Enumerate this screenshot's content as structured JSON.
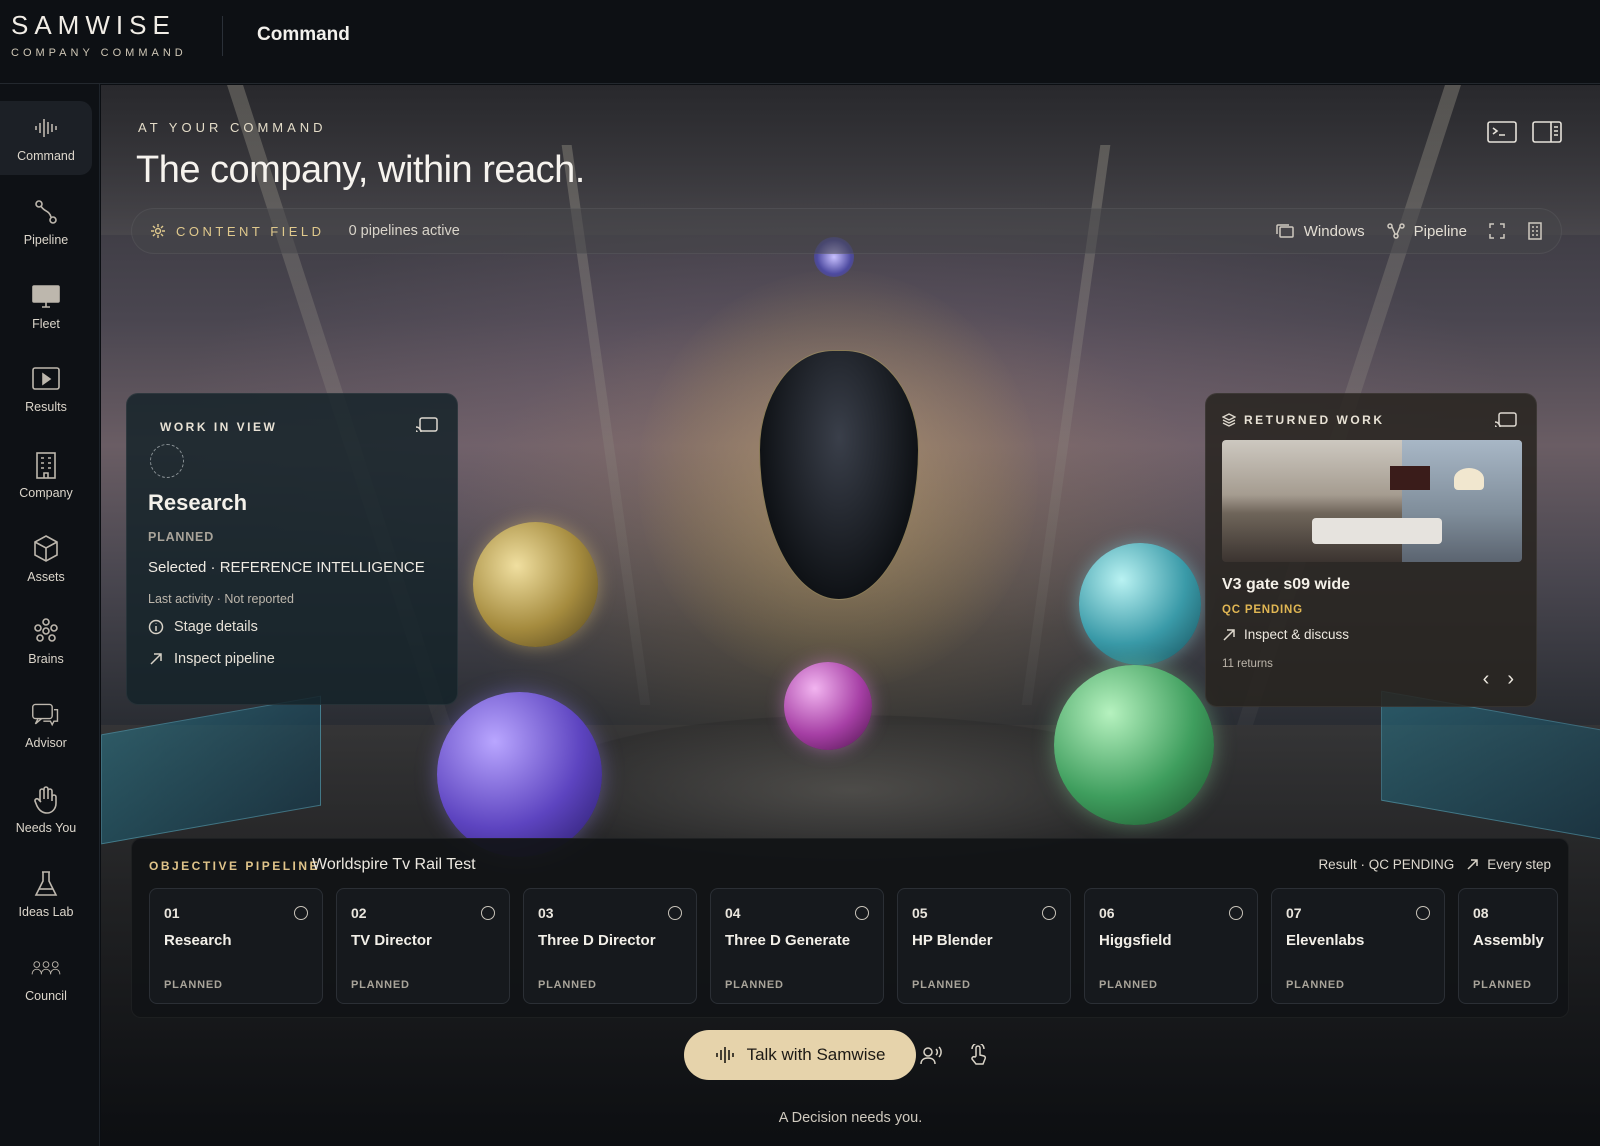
{
  "brand": {
    "name": "SAMWISE",
    "subtitle": "COMPANY COMMAND"
  },
  "topbar": {
    "title": "Command"
  },
  "sidebar": {
    "items": [
      {
        "label": "Command",
        "icon": "waveform-icon",
        "active": true
      },
      {
        "label": "Pipeline",
        "icon": "pipeline-icon"
      },
      {
        "label": "Fleet",
        "icon": "monitor-icon"
      },
      {
        "label": "Results",
        "icon": "play-icon"
      },
      {
        "label": "Company",
        "icon": "building-icon"
      },
      {
        "label": "Assets",
        "icon": "cube-icon"
      },
      {
        "label": "Brains",
        "icon": "brain-network-icon"
      },
      {
        "label": "Advisor",
        "icon": "chat-bubbles-icon"
      },
      {
        "label": "Needs You",
        "icon": "hand-icon"
      },
      {
        "label": "Ideas Lab",
        "icon": "flask-icon"
      },
      {
        "label": "Council",
        "icon": "people-group-icon"
      }
    ]
  },
  "hero": {
    "kicker": "AT YOUR COMMAND",
    "headline": "The company, within reach."
  },
  "field_bar": {
    "label": "CONTENT FIELD",
    "count": "0 pipelines active",
    "windows_label": "Windows",
    "pipeline_label": "Pipeline"
  },
  "work_in_view": {
    "kicker": "WORK IN VIEW",
    "title": "Research",
    "status": "PLANNED",
    "selected": "Selected · REFERENCE INTELLIGENCE",
    "activity": "Last activity · Not reported",
    "stage_details": "Stage details",
    "inspect_pipeline": "Inspect pipeline"
  },
  "returned_work": {
    "kicker": "RETURNED WORK",
    "title": "V3 gate s09 wide",
    "status": "QC PENDING",
    "action": "Inspect & discuss",
    "count": "11 returns",
    "prev": "‹",
    "next": "›"
  },
  "objective_pipeline": {
    "kicker": "OBJECTIVE PIPELINE",
    "name": "Worldspire Tv Rail Test",
    "result": "Result · QC PENDING",
    "every_step": "Every step",
    "steps": [
      {
        "num": "01",
        "name": "Research",
        "status": "PLANNED"
      },
      {
        "num": "02",
        "name": "TV Director",
        "status": "PLANNED"
      },
      {
        "num": "03",
        "name": "Three D Director",
        "status": "PLANNED"
      },
      {
        "num": "04",
        "name": "Three D Generate",
        "status": "PLANNED"
      },
      {
        "num": "05",
        "name": "HP Blender",
        "status": "PLANNED"
      },
      {
        "num": "06",
        "name": "Higgsfield",
        "status": "PLANNED"
      },
      {
        "num": "07",
        "name": "Elevenlabs",
        "status": "PLANNED"
      },
      {
        "num": "08",
        "name": "Assembly",
        "status": "PLANNED"
      }
    ]
  },
  "talk": {
    "label": "Talk with Samwise",
    "decision": "A Decision needs you."
  },
  "colors": {
    "accent_gold": "#e0c48a",
    "talk_button": "#e6d3ab",
    "qc_pending": "#e0b653",
    "background": "#0b0e12"
  }
}
